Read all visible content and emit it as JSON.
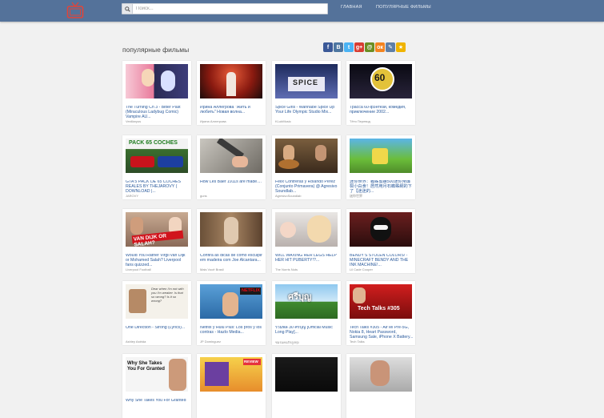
{
  "header": {
    "search_placeholder": "Поиск...",
    "nav": [
      "ГЛАВНАЯ",
      "ПОПУЛЯРНЫЕ ФИЛЬМЫ"
    ]
  },
  "page": {
    "title": "популярные фильмы"
  },
  "share": [
    {
      "name": "facebook",
      "glyph": "f",
      "color": "#3b5998"
    },
    {
      "name": "vkontakte",
      "glyph": "В",
      "color": "#4d76a1"
    },
    {
      "name": "twitter",
      "glyph": "t",
      "color": "#4ab3f4"
    },
    {
      "name": "google-plus",
      "glyph": "g+",
      "color": "#d73d32"
    },
    {
      "name": "myworld",
      "glyph": "@",
      "color": "#6b8e23"
    },
    {
      "name": "odnoklassniki",
      "glyph": "ок",
      "color": "#f48420"
    },
    {
      "name": "livejournal",
      "glyph": "✎",
      "color": "#5e7fa8"
    },
    {
      "name": "favorites",
      "glyph": "★",
      "color": "#f0b400"
    }
  ],
  "videos": [
    {
      "title": "The Turning Ch 3 - Bitter Past (Miraculous Ladybug Comic) Vampire AU...",
      "author": "Vexillaryus",
      "thumb": "ladybug"
    },
    {
      "title": "Ирина Аллегрова \"Жить и любить\" Новая волна...",
      "author": "Ирина Аллегрова",
      "thumb": "stage-red"
    },
    {
      "title": "Spice Girls - Wannabe Spice Up Your Life Olympic Studio Mix...",
      "author": "KLubMusic",
      "thumb": "spice"
    },
    {
      "title": "Трасса 60-фэнтези, комедия, приключение 2002...",
      "author": "Тётя Перевод",
      "thumb": "trassa60"
    },
    {
      "title": "GTA 5 PACK DE 65 COCHES REALES BY THEJAROVY ( DOWNLOAD |...",
      "author": "JAROVY",
      "thumb": "gta-coches"
    },
    {
      "title": "How Les Baer 1911s are made....",
      "author": "guns",
      "thumb": "gunsmith"
    },
    {
      "title": "Felix Contreras y Rolando Perez (Conjunto Primavera) @ Agresivo Soundlab...",
      "author": "AgresivoSoundlab",
      "thumb": "musicians"
    },
    {
      "title": "迷你世界：蜘蛛蜜蜂500迷你幣爆裂小白食！居然用月石蜘蛛網的下了【迷迷的...",
      "author": "迷你世界",
      "thumb": "minigame"
    },
    {
      "title": "Would You Rather Virgil van Dijk or Mohamed Salah? Liverpool fans quizzed...",
      "author": "Liverpool Football",
      "thumb": "vandijk"
    },
    {
      "title": "Confira as dicas de como esculpir em madeira com Joe Alcantara...",
      "author": "Mais Você Brasil",
      "thumb": "crowd"
    },
    {
      "title": "WILL WAXING HER LEGS HELP HER HIT PUBERTY!?...",
      "author": "The Norris Nuts",
      "thumb": "waxing"
    },
    {
      "title": "BENDY'S STOLEN COLORS! - MINECRAFT BENDY AND THE INK MACHINE!...",
      "author": "Lil Cade Cooper",
      "thumb": "bendy"
    },
    {
      "title": "One Direction - Strong (Lyrics)...",
      "author": "Ashley Astrida",
      "thumb": "lyrics"
    },
    {
      "title": "Netflix y Hulu Plus: Los pros y los contras - Hazlo Media...",
      "author": "JP Dominguez",
      "thumb": "netflix"
    },
    {
      "title": "รวมพล 30 ศรีบุญ [Official Music Long Play]...",
      "author": "ชมรมคนรักลูกทุ่ง",
      "thumb": "thai-field"
    },
    {
      "title": "Tech Talks #305 - AirTel Pre-5G, Nokia 8, Heart Password, Samsung Sale, iPhone X Battery...",
      "author": "Tech Talks",
      "thumb": "techtalks"
    },
    {
      "title": "Why She Takes You For Granted",
      "author": "",
      "thumb": "why-she"
    },
    {
      "title": "",
      "author": "",
      "thumb": "review"
    },
    {
      "title": "",
      "author": "",
      "thumb": "dark"
    },
    {
      "title": "",
      "author": "",
      "thumb": "man"
    }
  ],
  "thumb_text": {
    "gta-coches": "PACK 65 COCHES",
    "vandijk": "VAN DIJK OR SALAH?",
    "lyrics": "Dear when I'm not with you I'm weaker. Is that so wrong? Is it so wrong?",
    "netflix": "NETFLIX",
    "thai-field": "ศรีบุญ",
    "techtalks": "Tech Talks #305",
    "why-she": "Why She Takes You For Granted",
    "review": "REVIEW",
    "trassa60": "60",
    "waxing": "20",
    "spice": "SPICE"
  },
  "colors": {
    "header": "#54729a",
    "link": "#2a5a9c",
    "background": "#f1f1f1",
    "logo": "#e0453a"
  }
}
